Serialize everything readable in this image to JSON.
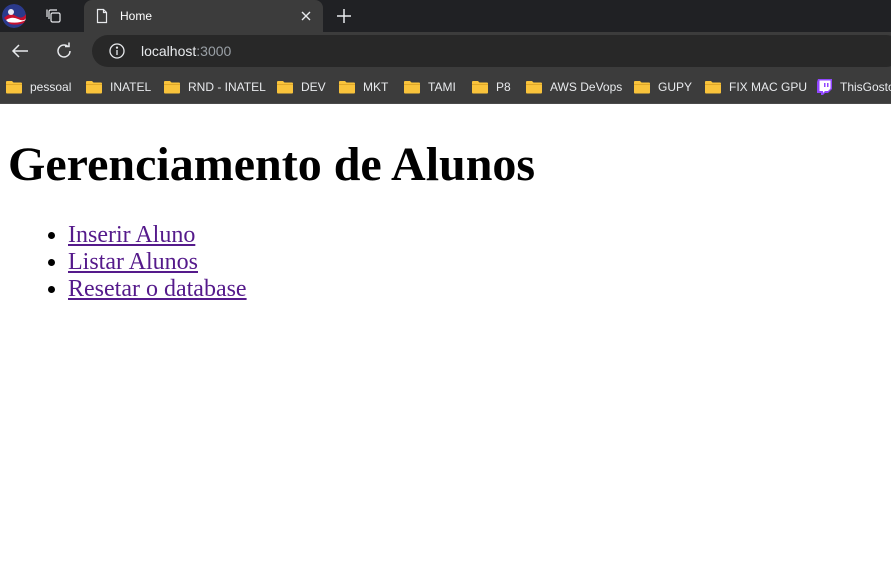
{
  "browser": {
    "tab": {
      "title": "Home"
    },
    "address": {
      "host": "localhost",
      "port": ":3000"
    },
    "bookmarks": [
      {
        "label": "pessoal",
        "icon": "folder-icon"
      },
      {
        "label": "INATEL",
        "icon": "folder-icon"
      },
      {
        "label": "RND - INATEL",
        "icon": "folder-icon"
      },
      {
        "label": "DEV",
        "icon": "folder-icon"
      },
      {
        "label": "MKT",
        "icon": "folder-icon"
      },
      {
        "label": "TAMI",
        "icon": "folder-icon"
      },
      {
        "label": "P8",
        "icon": "folder-icon"
      },
      {
        "label": "AWS DeVops",
        "icon": "folder-icon"
      },
      {
        "label": "GUPY",
        "icon": "folder-icon"
      },
      {
        "label": "FIX MAC GPU",
        "icon": "folder-icon"
      },
      {
        "label": "ThisGostos",
        "icon": "twitch-icon"
      }
    ],
    "colors": {
      "folder": "#f9c33b",
      "twitch": "#9146ff",
      "link_visited": "#551a8b"
    }
  },
  "page": {
    "title": "Gerenciamento de Alunos",
    "links": [
      {
        "label": "Inserir Aluno"
      },
      {
        "label": "Listar Alunos"
      },
      {
        "label": "Resetar o database"
      }
    ]
  }
}
